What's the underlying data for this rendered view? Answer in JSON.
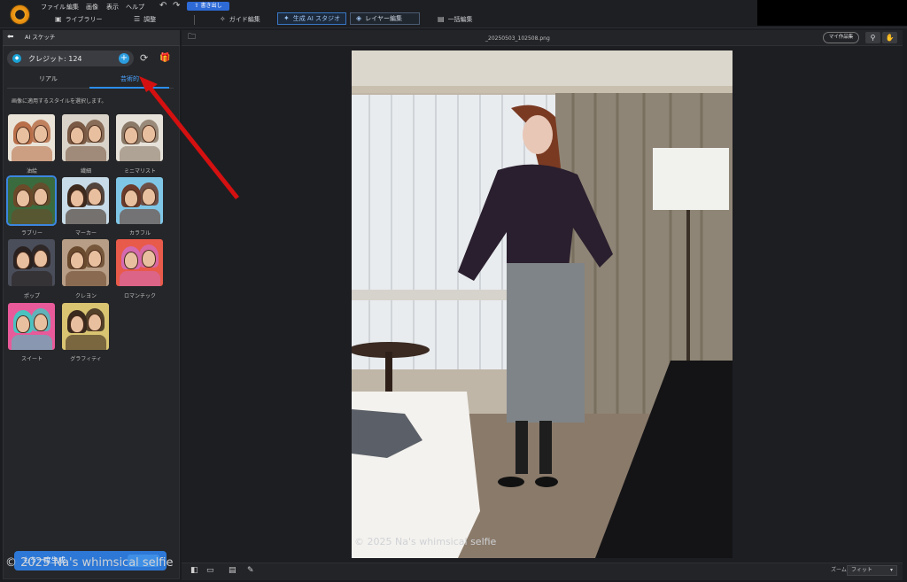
{
  "menu": {
    "items": [
      "ファイル",
      "編集",
      "画像",
      "表示",
      "ヘルプ"
    ],
    "undo": "↶",
    "redo": "↷",
    "export": "書き出し"
  },
  "tabs": [
    {
      "label": "ライブラリー",
      "icon": "library-icon"
    },
    {
      "label": "調整",
      "icon": "sliders-icon"
    },
    {
      "label": "ガイド編集",
      "icon": "magic-wand-icon"
    },
    {
      "label": "生成 AI スタジオ",
      "icon": "sparkle-icon"
    },
    {
      "label": "レイヤー編集",
      "icon": "layers-icon"
    },
    {
      "label": "一括編集",
      "icon": "batch-icon"
    }
  ],
  "panel": {
    "title": "AI スケッチ",
    "credits": "クレジット: 124",
    "tabs": [
      "リアル",
      "芸術的"
    ],
    "active_tab": "芸術的",
    "hint": "画像に適用するスタイルを選択します。",
    "styles": [
      {
        "label": "油絵"
      },
      {
        "label": "繊細"
      },
      {
        "label": "ミニマリスト"
      },
      {
        "label": "ラブリー"
      },
      {
        "label": "マーカー"
      },
      {
        "label": "カラフル"
      },
      {
        "label": "ポップ"
      },
      {
        "label": "クレヨン"
      },
      {
        "label": "ロマンチック"
      },
      {
        "label": "スイート"
      },
      {
        "label": "グラフィティ"
      }
    ],
    "selected_style": "ラブリー",
    "generate": "もう一度生成"
  },
  "workspace": {
    "filename": "_20250503_102508.png",
    "my_works": "マイ作品集",
    "zoom_label": "ズーム",
    "zoom_value": "フィット"
  },
  "watermark": "© 2025 Na's whimsical selfie",
  "colors": {
    "accent": "#2d78d6",
    "annotation_arrow": "#d41010",
    "active_tab_border": "#3977c6"
  }
}
